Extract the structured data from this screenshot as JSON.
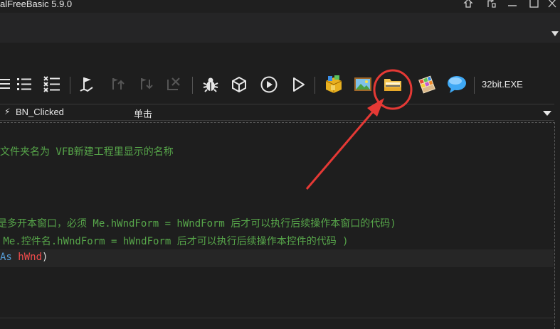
{
  "window": {
    "title": "alFreeBasic 5.9.0"
  },
  "toolbar": {
    "exe_label": "32bit.EXE"
  },
  "event_bar": {
    "event_name": "BN_Clicked",
    "event_desc": "单击"
  },
  "editor": {
    "lines": [
      "文件夹名为 VFB新建工程里显示的名称",
      "是多开本窗口，必须 Me.hWndForm = hWndForm 后才可以执行后续操作本窗口的代码)",
      " Me.控件名.hWndForm = hWndForm 后才可以执行后续操作本控件的代码 )"
    ],
    "code_line": {
      "kw": "As",
      "var": "hWnd",
      "paren": ")"
    }
  },
  "annotation": {
    "circle_color": "#e53935",
    "arrow_color": "#e53935"
  }
}
